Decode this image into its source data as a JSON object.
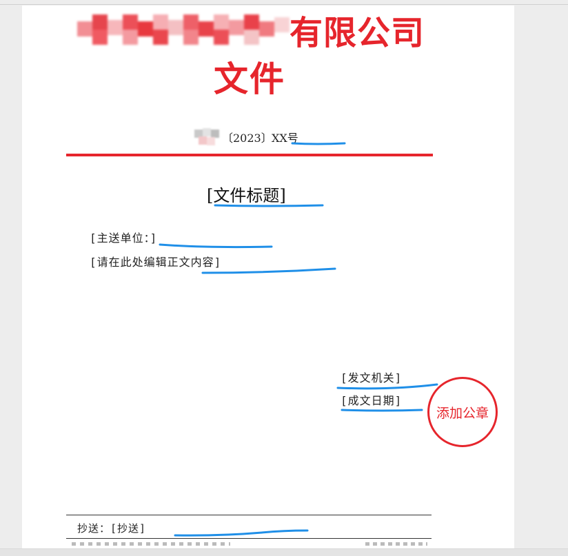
{
  "header": {
    "company_suffix": "有限公司",
    "doc_word": "文件",
    "doc_number_year": "〔2023〕",
    "doc_number_code": "XX号"
  },
  "body": {
    "title": "[文件标题]",
    "recipient": "[主送单位：]",
    "content": "[请在此处编辑正文内容]",
    "issuer": "[发文机关]",
    "date": "[成文日期]"
  },
  "seal": {
    "label": "添加公章"
  },
  "footer": {
    "cc": "抄送：[抄送]"
  },
  "colors": {
    "header_red": "#e6252c",
    "annotation_blue": "#1f8fe8"
  }
}
